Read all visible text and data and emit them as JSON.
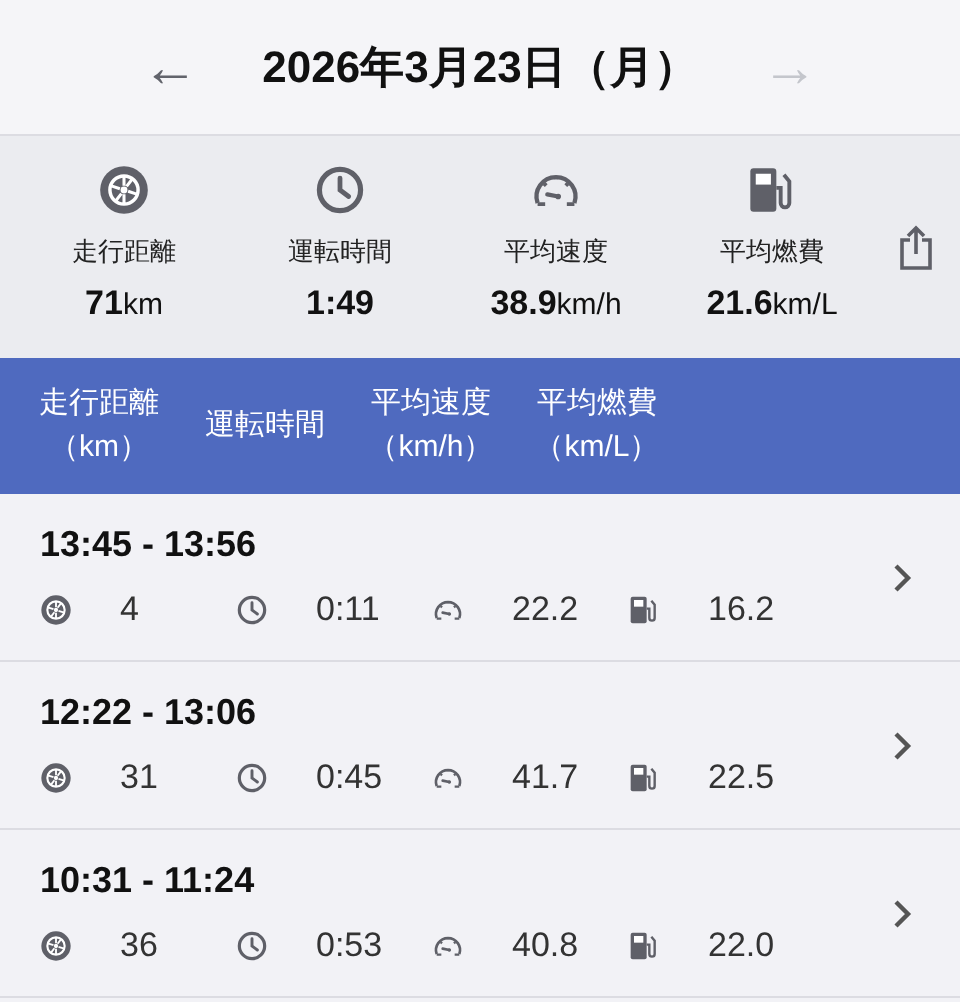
{
  "date_nav": {
    "back": {
      "label": "←",
      "disabled": false
    },
    "title": "2026年3月23日（月）",
    "forward": {
      "label": "→",
      "disabled": true
    }
  },
  "summary": [
    {
      "kind": "distance",
      "label": "走行距離",
      "value": "71",
      "unit": "km"
    },
    {
      "kind": "time",
      "label": "運転時間",
      "value": "1:49"
    },
    {
      "kind": "speed",
      "label": "平均速度",
      "value": "38.9",
      "unit": "km/h"
    },
    {
      "kind": "fuel",
      "label": "平均燃費",
      "value": "21.6",
      "unit": "km/L"
    }
  ],
  "table_header": [
    {
      "title": "走行距離",
      "unit": "（km）"
    },
    {
      "title": "運転時間"
    },
    {
      "title": "平均速度",
      "unit": "（km/h）"
    },
    {
      "title": "平均燃費",
      "unit": "（km/L）"
    }
  ],
  "trips": [
    {
      "time_range": "13:45 - 13:56",
      "stats": [
        {
          "kind": "distance",
          "value": "4"
        },
        {
          "kind": "time",
          "value": "0:11"
        },
        {
          "kind": "speed",
          "value": "22.2"
        },
        {
          "kind": "fuel",
          "value": "16.2"
        }
      ]
    },
    {
      "time_range": "12:22 - 13:06",
      "stats": [
        {
          "kind": "distance",
          "value": "31"
        },
        {
          "kind": "time",
          "value": "0:45"
        },
        {
          "kind": "speed",
          "value": "41.7"
        },
        {
          "kind": "fuel",
          "value": "22.5"
        }
      ]
    },
    {
      "time_range": "10:31 - 11:24",
      "stats": [
        {
          "kind": "distance",
          "value": "36"
        },
        {
          "kind": "time",
          "value": "0:53"
        },
        {
          "kind": "speed",
          "value": "40.8"
        },
        {
          "kind": "fuel",
          "value": "22.0"
        }
      ]
    }
  ]
}
